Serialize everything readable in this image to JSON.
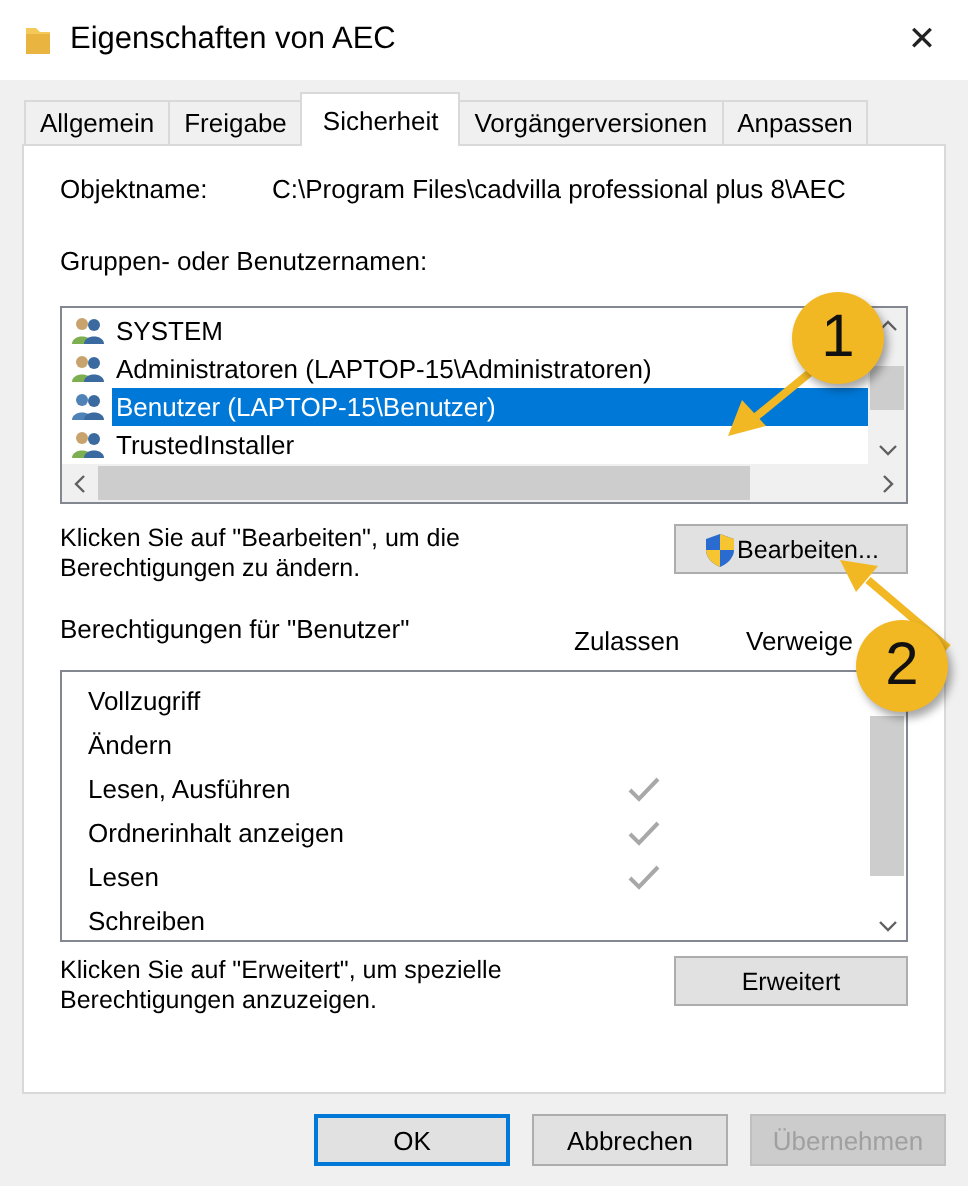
{
  "window": {
    "title": "Eigenschaften von AEC",
    "close": "✕"
  },
  "tabs": [
    {
      "label": "Allgemein",
      "selected": false
    },
    {
      "label": "Freigabe",
      "selected": false
    },
    {
      "label": "Sicherheit",
      "selected": true
    },
    {
      "label": "Vorgängerversionen",
      "selected": false
    },
    {
      "label": "Anpassen",
      "selected": false
    }
  ],
  "object_name": {
    "label": "Objektname:",
    "value": "C:\\Program Files\\cadvilla professional plus 8\\AEC"
  },
  "groups": {
    "label": "Gruppen- oder Benutzernamen:",
    "items": [
      {
        "name": "SYSTEM",
        "selected": false
      },
      {
        "name": "Administratoren (LAPTOP-15\\Administratoren)",
        "selected": false
      },
      {
        "name": "Benutzer (LAPTOP-15\\Benutzer)",
        "selected": true
      },
      {
        "name": "TrustedInstaller",
        "selected": false
      }
    ]
  },
  "edit_hint": "Klicken Sie auf \"Bearbeiten\", um die Berechtigungen zu ändern.",
  "edit_button": "Bearbeiten...",
  "permissions": {
    "label": "Berechtigungen für \"Benutzer\"",
    "allow_header": "Zulassen",
    "deny_header": "Verweige",
    "items": [
      {
        "name": "Vollzugriff",
        "allow": false
      },
      {
        "name": "Ändern",
        "allow": false
      },
      {
        "name": "Lesen, Ausführen",
        "allow": true
      },
      {
        "name": "Ordnerinhalt anzeigen",
        "allow": true
      },
      {
        "name": "Lesen",
        "allow": true
      },
      {
        "name": "Schreiben",
        "allow": false
      }
    ]
  },
  "advanced_hint": "Klicken Sie auf \"Erweitert\", um spezielle Berechtigungen anzuzeigen.",
  "advanced_button": "Erweitert",
  "buttons": [
    {
      "label": "OK",
      "kind": "default",
      "disabled": false
    },
    {
      "label": "Abbrechen",
      "kind": "normal",
      "disabled": false
    },
    {
      "label": "Übernehmen",
      "kind": "normal",
      "disabled": true
    }
  ],
  "callouts": [
    {
      "label": "1"
    },
    {
      "label": "2"
    }
  ]
}
